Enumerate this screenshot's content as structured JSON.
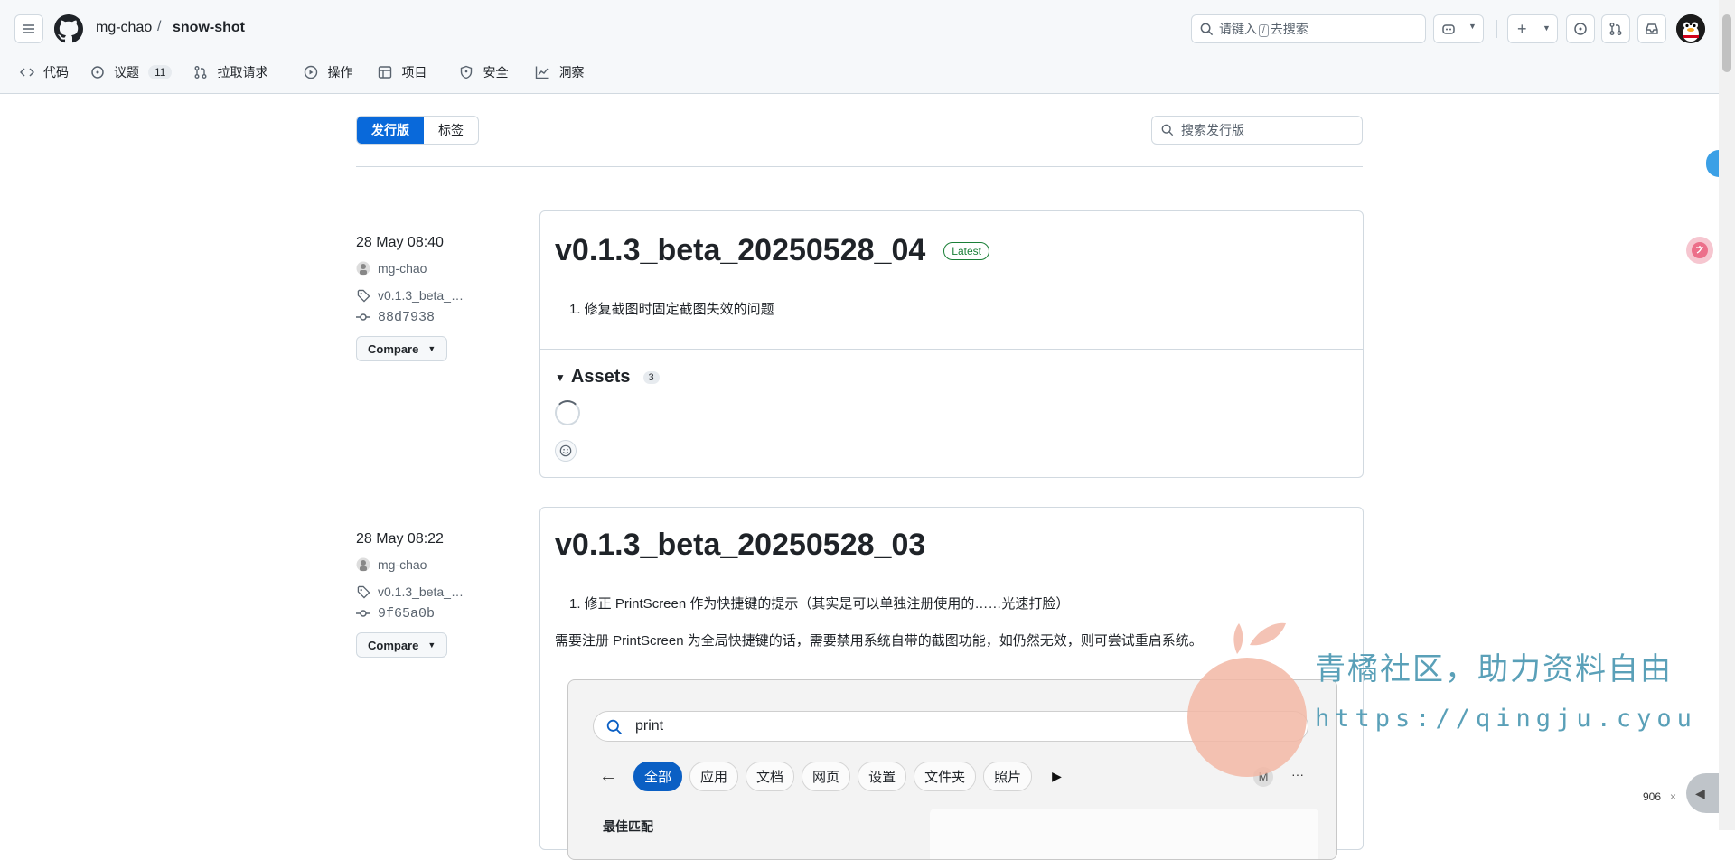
{
  "header": {
    "owner": "mg-chao",
    "separator": "/",
    "repo": "snow-shot",
    "search_prefix": "请键入",
    "search_key": "/",
    "search_suffix": "去搜索",
    "plus_label": "+"
  },
  "repo_tabs": [
    {
      "label": "代码",
      "icon": "code-icon"
    },
    {
      "label": "议题",
      "icon": "issue-icon",
      "count": "11"
    },
    {
      "label": "拉取请求",
      "icon": "pull-request-icon"
    },
    {
      "label": "操作",
      "icon": "play-icon"
    },
    {
      "label": "项目",
      "icon": "table-icon"
    },
    {
      "label": "安全",
      "icon": "shield-icon"
    },
    {
      "label": "洞察",
      "icon": "graph-icon"
    }
  ],
  "releases_toolbar": {
    "tab_releases": "发行版",
    "tab_tags": "标签",
    "search_placeholder": "搜索发行版"
  },
  "releases": [
    {
      "date": "28 May 08:40",
      "author": "mg-chao",
      "tag": "v0.1.3_beta_…",
      "commit": "88d7938",
      "compare_label": "Compare",
      "title": "v0.1.3_beta_20250528_04",
      "latest_label": "Latest",
      "notes": [
        "1. 修复截图时固定截图失效的问题"
      ],
      "assets_label": "Assets",
      "assets_count": "3"
    },
    {
      "date": "28 May 08:22",
      "author": "mg-chao",
      "tag": "v0.1.3_beta_…",
      "commit": "9f65a0b",
      "compare_label": "Compare",
      "title": "v0.1.3_beta_20250528_03",
      "notes": [
        "1. 修正 PrintScreen 作为快捷键的提示（其实是可以单独注册使用的……光速打脸）",
        "需要注册 PrintScreen 为全局快捷键的话，需要禁用系统自带的截图功能，如仍然无效，则可尝试重启系统。"
      ]
    }
  ],
  "embedded_screenshot": {
    "search_text": "print",
    "chips": [
      "全部",
      "应用",
      "文档",
      "网页",
      "设置",
      "文件夹",
      "照片"
    ],
    "avatar_letter": "M",
    "more": "···",
    "best_match": "最佳匹配"
  },
  "watermark": {
    "line1": "青橘社区，助力资料自由",
    "line2": "https://qingju.cyou"
  },
  "widget": {
    "counter": "906",
    "close": "×"
  }
}
